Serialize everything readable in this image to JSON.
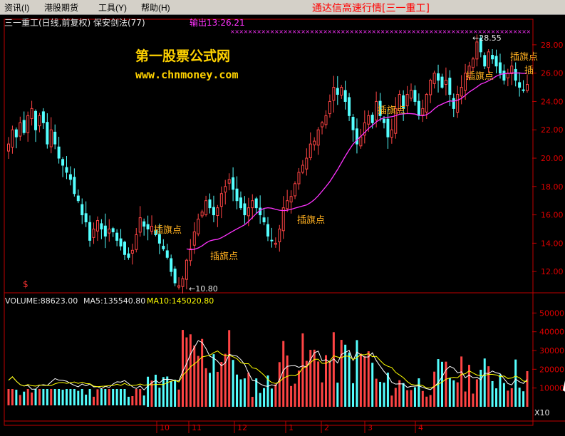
{
  "menu": {
    "items": [
      "资讯(I)",
      "港股期货",
      "工具(Y)",
      "帮助(H)"
    ],
    "title": "通达信高速行情[三一重工]"
  },
  "header": {
    "stock": "三一重工(日线,前复权) 保安剑法(77)",
    "output": "输出13:26.21"
  },
  "watermark": {
    "line1": "第一股票公式网",
    "line2": "www.chnmoney.com"
  },
  "signal_marker": "$",
  "colors": {
    "up": "#ff4444",
    "down": "#54ffff",
    "ma": "#ff33ff",
    "annotation": "#ffb020",
    "volume_ma5": "#ffffff",
    "volume_ma10": "#ffff00"
  },
  "volume_header": {
    "volume": "VOLUME:88623.00",
    "ma5": "MA5:135540.80",
    "ma10": "MA10:145020.80"
  },
  "chart_data": [
    {
      "type": "candlestick",
      "ylim": [
        10.5,
        29.2
      ],
      "y_ticks": [
        12,
        14,
        16,
        18,
        20,
        22,
        24,
        26,
        28
      ],
      "y_tick_labels": [
        "12.00",
        "14.00",
        "16.00",
        "18.00",
        "20.00",
        "22.00",
        "24.00",
        "26.00",
        "28.00"
      ],
      "annotations": [
        "插旗点",
        "插旗点",
        "插旗点",
        "插旗点",
        "插旗点",
        "插旗点"
      ],
      "extremes": {
        "low": {
          "label": "←10.80",
          "value": 10.8
        },
        "high": {
          "label": "←28.55",
          "value": 28.55
        }
      },
      "closes": [
        21.0,
        22.0,
        21.5,
        22.5,
        21.8,
        23.0,
        23.5,
        22.0,
        23.0,
        22.5,
        21.0,
        22.0,
        21.0,
        20.0,
        19.5,
        19.0,
        18.5,
        17.5,
        17.0,
        16.0,
        15.5,
        14.2,
        15.0,
        15.6,
        15.0,
        14.5,
        15.0,
        14.8,
        14.2,
        13.8,
        13.2,
        13.0,
        13.5,
        14.6,
        15.8,
        15.2,
        15.0,
        15.2,
        14.6,
        14.0,
        13.6,
        13.0,
        12.0,
        11.2,
        11.0,
        11.5,
        12.8,
        13.6,
        14.8,
        15.7,
        16.2,
        17.0,
        16.5,
        16.0,
        16.5,
        17.5,
        18.0,
        18.5,
        17.8,
        17.0,
        16.5,
        16.0,
        16.5,
        17.0,
        16.5,
        16.0,
        15.5,
        14.5,
        14.2,
        14.0,
        15.0,
        16.5,
        17.0,
        17.3,
        18.2,
        19.0,
        19.5,
        20.0,
        21.0,
        21.2,
        22.0,
        22.5,
        23.0,
        24.0,
        25.0,
        24.5,
        25.0,
        24.0,
        23.0,
        22.0,
        21.0,
        21.5,
        22.5,
        23.0,
        22.5,
        24.0,
        23.0,
        22.5,
        21.5,
        22.0,
        23.5,
        24.5,
        23.5,
        24.5,
        24.8,
        24.0,
        23.0,
        23.5,
        24.5,
        25.5,
        26.0,
        25.5,
        25.0,
        25.5,
        24.5,
        23.5,
        24.5,
        25.0,
        26.0,
        26.5,
        27.0,
        28.2,
        27.5,
        26.5,
        27.5,
        27.0,
        26.5,
        26.0,
        25.5,
        26.0,
        26.5,
        25.5,
        25.0,
        24.8,
        25.2
      ]
    },
    {
      "type": "bar",
      "ylim": [
        0,
        60000
      ],
      "y_ticks": [
        10000,
        20000,
        30000,
        40000,
        50000
      ],
      "y_tick_labels": [
        "10000",
        "20000",
        "30000",
        "40000",
        "50000"
      ],
      "unit_label": "X10",
      "x_tick_labels": [
        "10",
        "11",
        "12",
        "1",
        "2",
        "3",
        "4"
      ]
    }
  ]
}
